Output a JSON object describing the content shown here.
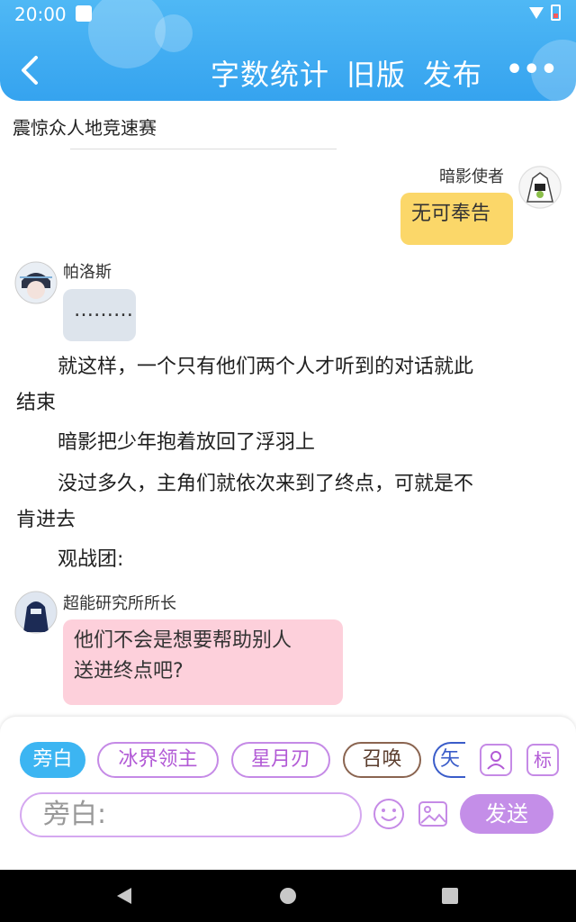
{
  "status_bar": {
    "time": "20:00"
  },
  "header": {
    "word_count_label": "字数统计",
    "old_version_label": "旧版",
    "publish_label": "发布",
    "more_label": "•••"
  },
  "story": {
    "title": "震惊众人地竞速赛"
  },
  "messages": {
    "m1": {
      "name": "暗影使者",
      "text": "无可奉告"
    },
    "m2": {
      "name": "帕洛斯",
      "text": "………"
    },
    "m3": {
      "name": "超能研究所所长",
      "text_line1": "他们不会是想要帮助别人",
      "text_line2": "送进终点吧?"
    }
  },
  "narrations": {
    "n1_line1": "就这样，一个只有他们两个人才听到的对话就此",
    "n1_line2": "结束",
    "n2": "暗影把少年抱着放回了浮羽上",
    "n3_line1": "没过多久，主角们就依次来到了终点，可就是不",
    "n3_line2": "肯进去",
    "n4": "观战团:"
  },
  "composer": {
    "chips": [
      "旁白",
      "冰界领主",
      "星月刃",
      "召唤",
      "矢"
    ],
    "tag_label": "标",
    "input_placeholder": "旁白:",
    "send_label": "发送"
  },
  "colors": {
    "header": "#35a3ef",
    "bubble_right": "#fbd769",
    "bubble_gray": "#dde4ec",
    "bubble_pink": "#fdd0db",
    "accent_purple": "#c48ee8"
  }
}
